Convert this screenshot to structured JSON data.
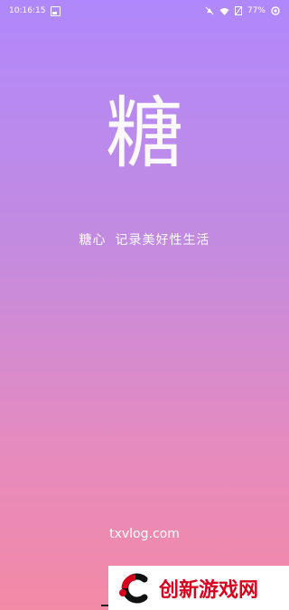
{
  "status_bar": {
    "time": "10:16:15",
    "battery": "77%"
  },
  "splash": {
    "logo_char": "糖",
    "brand": "糖心",
    "slogan": "记录美好性生活",
    "domain": "txvlog.com"
  },
  "watermark": {
    "text": "创新游戏网",
    "logo_letter": "C"
  },
  "colors": {
    "gradient_top": "#b088fb",
    "gradient_bottom": "#f38aa6",
    "watermark_red": "#d6001c"
  }
}
